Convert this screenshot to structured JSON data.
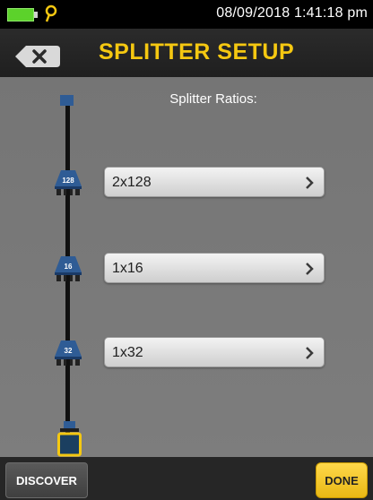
{
  "status_bar": {
    "datetime": "08/09/2018 1:41:18 pm",
    "battery_icon": "battery-icon",
    "location_icon": "pin-icon"
  },
  "header": {
    "title": "SPLITTER SETUP",
    "back_icon": "back-x-icon"
  },
  "main": {
    "section_label": "Splitter Ratios:",
    "splitters": [
      {
        "icon_label": "128",
        "ratio": "2x128"
      },
      {
        "icon_label": "16",
        "ratio": "1x16"
      },
      {
        "icon_label": "32",
        "ratio": "1x32"
      }
    ]
  },
  "footer": {
    "discover_label": "DISCOVER",
    "done_label": "DONE"
  },
  "colors": {
    "accent": "#f5c811",
    "splitter_blue": "#2f5c95",
    "connector_yellow": "#f5c811"
  }
}
